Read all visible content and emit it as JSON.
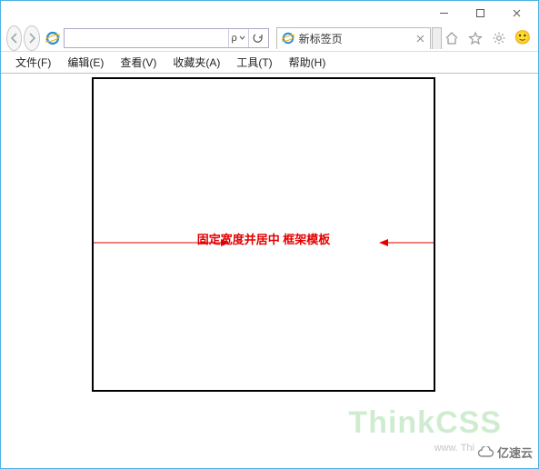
{
  "window": {
    "minimize_tip": "最小化",
    "maximize_tip": "最大化",
    "close_tip": "关闭"
  },
  "toolbar": {
    "search_hint": "ρ",
    "refresh_tip": "刷新",
    "address_value": ""
  },
  "tab": {
    "label": "新标签页",
    "close_tip": "关闭标签页"
  },
  "icons": {
    "home_tip": "主页",
    "favorites_tip": "收藏夹",
    "tools_tip": "工具",
    "emoji": "🙂"
  },
  "menu": {
    "items": [
      "文件(F)",
      "编辑(E)",
      "查看(V)",
      "收藏夹(A)",
      "工具(T)",
      "帮助(H)"
    ]
  },
  "annotation": {
    "text": "固定宽度并居中 框架模板"
  },
  "watermark": {
    "main": "ThinkCSS",
    "sub": "www. Thi",
    "brand": "亿速云"
  }
}
